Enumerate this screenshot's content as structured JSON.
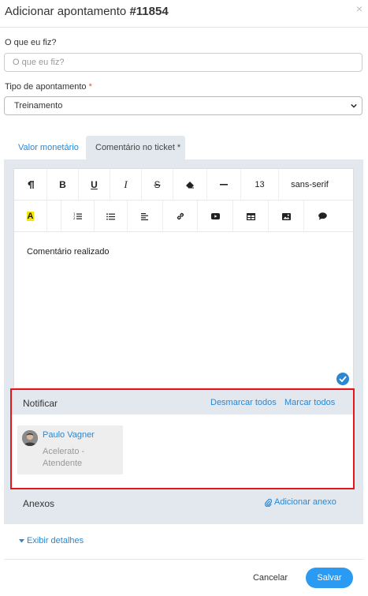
{
  "header": {
    "title_prefix": "Adicionar apontamento ",
    "title_number": "#11854",
    "close": "×"
  },
  "form": {
    "what_label": "O que eu fiz?",
    "what_placeholder": "O que eu fiz?",
    "what_value": "",
    "type_label": "Tipo de apontamento",
    "type_required": "*",
    "type_value": "Treinamento"
  },
  "tabs": [
    {
      "label": "Valor monetário",
      "active": false
    },
    {
      "label": "Comentário no ticket *",
      "active": true
    }
  ],
  "editor": {
    "toolbar_row1": [
      "paragraph-icon",
      "bold-icon",
      "underline-icon",
      "italic-icon",
      "strikethrough-icon",
      "eraser-icon",
      "horizontal-rule-icon"
    ],
    "font_size": "13",
    "font_family": "sans-serif",
    "toolbar_row2": [
      "text-color-icon",
      "ordered-list-icon",
      "unordered-list-icon",
      "align-left-icon",
      "link-icon",
      "video-icon",
      "table-icon",
      "image-icon",
      "comment-icon"
    ],
    "content": "Comentário realizado",
    "highlight_color": "#f5e600"
  },
  "notify": {
    "title": "Notificar",
    "unselect_all": "Desmarcar todos",
    "select_all": "Marcar todos",
    "users": [
      {
        "name": "Paulo Vagner",
        "role": "Acelerato - Atendente"
      }
    ]
  },
  "attachments": {
    "title": "Anexos",
    "add_label": "Adicionar anexo"
  },
  "details_label": "Exibir detalhes",
  "footer": {
    "cancel": "Cancelar",
    "save": "Salvar"
  },
  "colors": {
    "accent": "#2b87d1",
    "save_button": "#2b9af3",
    "highlight_border": "#e8141c",
    "panel_bg": "#e3e8ee"
  }
}
